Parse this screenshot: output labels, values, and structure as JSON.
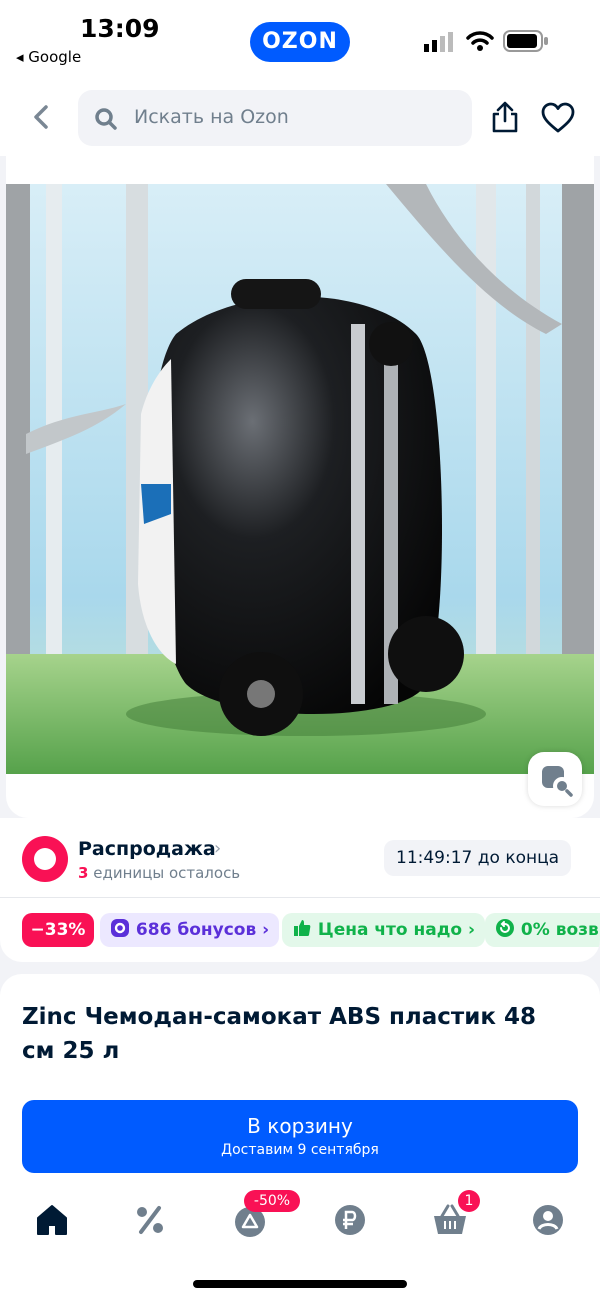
{
  "status_bar": {
    "time": "13:09",
    "back_app": "◂ Google"
  },
  "brand": {
    "logo": "OZON",
    "accent": "#005bff",
    "sale_color": "#f91155"
  },
  "search": {
    "placeholder": "Искать на Ozon"
  },
  "icons": [
    "chevron-left-icon",
    "search-icon",
    "share-icon",
    "heart-icon",
    "image-search-icon",
    "home-icon",
    "percent-icon",
    "bag-icon",
    "ruble-icon",
    "basket-icon",
    "profile-icon"
  ],
  "sale": {
    "title": "Распродажа",
    "chevron": "›",
    "left_count": "3",
    "left_text": "единицы осталось",
    "timer": "11:49:17 до конца"
  },
  "chips": {
    "discount": "−33%",
    "bonus": "686 бонусов ›",
    "price": "Цена что надо ›",
    "return": "0% возв"
  },
  "product": {
    "title": "Zinc Чемодан-самокат ABS пластик 48 см 25 л"
  },
  "cart": {
    "label": "В корзину",
    "delivery": "Доставим 9 сентября"
  },
  "tabbar": {
    "promo_badge": "-50%",
    "cart_badge": "1"
  }
}
